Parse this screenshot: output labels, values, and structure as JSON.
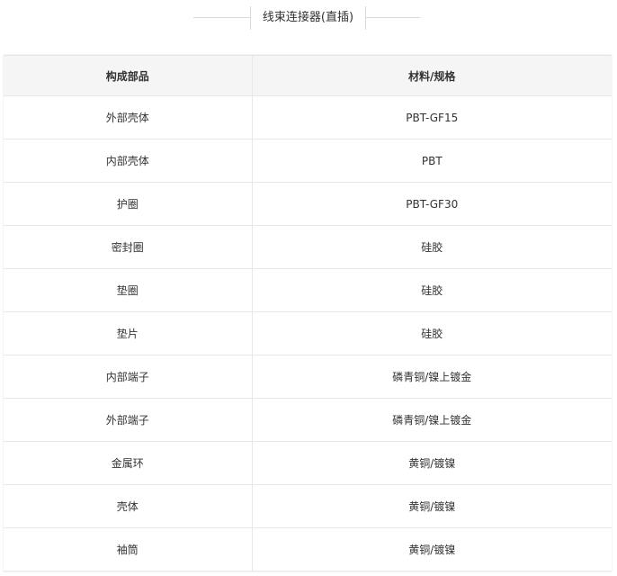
{
  "section_title": "线束连接器(直插)",
  "table": {
    "headers": [
      "构成部品",
      "材料/规格"
    ],
    "rows": [
      {
        "part": "外部壳体",
        "material": "PBT-GF15"
      },
      {
        "part": "内部壳体",
        "material": "PBT"
      },
      {
        "part": "护圈",
        "material": "PBT-GF30"
      },
      {
        "part": "密封圈",
        "material": "硅胶"
      },
      {
        "part": "垫圈",
        "material": "硅胶"
      },
      {
        "part": "垫片",
        "material": "硅胶"
      },
      {
        "part": "内部端子",
        "material": "磷青铜/镍上镀金"
      },
      {
        "part": "外部端子",
        "material": "磷青铜/镍上镀金"
      },
      {
        "part": "金属环",
        "material": "黄铜/镀镍"
      },
      {
        "part": "壳体",
        "material": "黄铜/镀镍"
      },
      {
        "part": "袖筒",
        "material": "黄铜/镀镍"
      }
    ]
  }
}
